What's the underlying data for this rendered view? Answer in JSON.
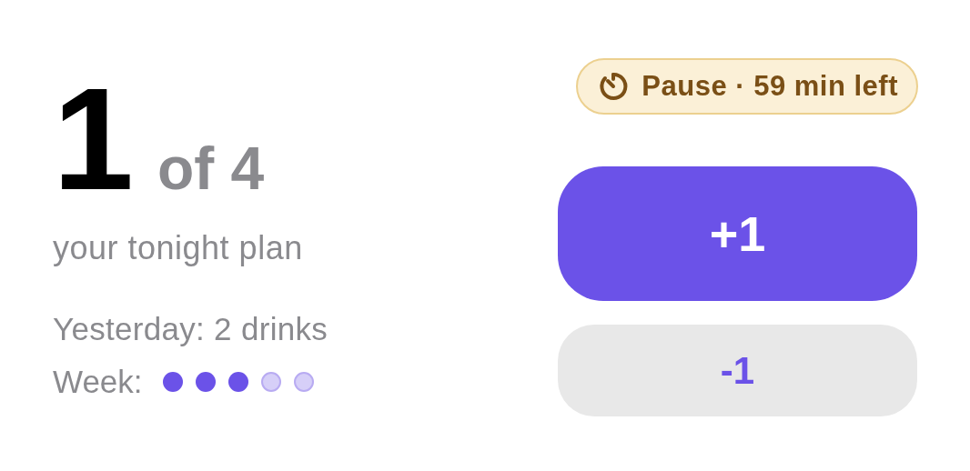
{
  "count": {
    "value": "1",
    "of": "of 4"
  },
  "subtitle": "your tonight plan",
  "yesterday": "Yesterday: 2 drinks",
  "week": {
    "label": "Week:",
    "days": [
      {
        "filled": true
      },
      {
        "filled": true
      },
      {
        "filled": true
      },
      {
        "filled": false
      },
      {
        "filled": false
      }
    ]
  },
  "pause_badge": {
    "label": "Pause · 59 min left"
  },
  "buttons": [
    {
      "kind": "primary",
      "label": "+1"
    },
    {
      "kind": "secondary",
      "label": "-1"
    }
  ]
}
